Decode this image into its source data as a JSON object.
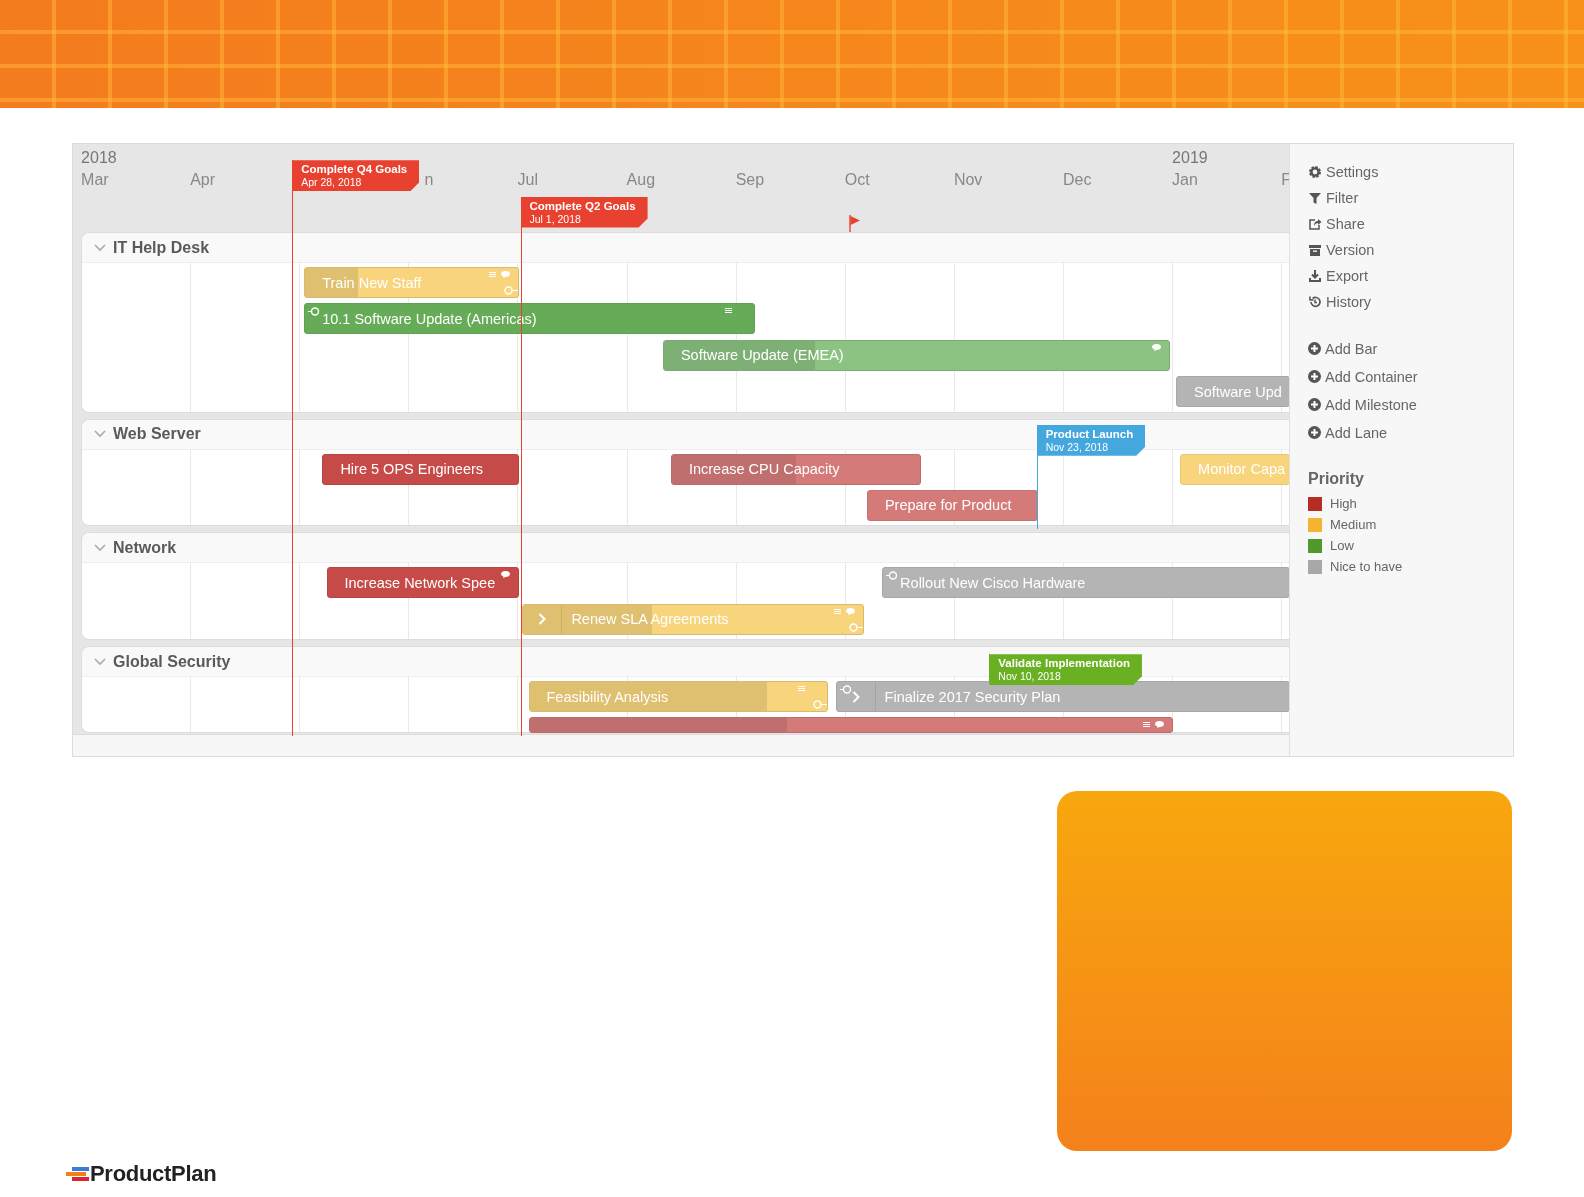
{
  "timeline": {
    "months": [
      {
        "label": "Mar",
        "year": "2018"
      },
      {
        "label": "Apr"
      },
      {
        "label": "n"
      },
      {
        "label": "Jul"
      },
      {
        "label": "Aug"
      },
      {
        "label": "Sep"
      },
      {
        "label": "Oct"
      },
      {
        "label": "Nov"
      },
      {
        "label": "Dec"
      },
      {
        "label": "Jan",
        "year": "2019"
      },
      {
        "label": "F"
      }
    ],
    "milestones": [
      {
        "label": "Complete Q4 Goals",
        "date": "Apr 28, 2018",
        "color": "#e8412f"
      },
      {
        "label": "Complete Q2 Goals",
        "date": "Jul 1, 2018",
        "color": "#e8412f"
      },
      {
        "label": "Product Launch",
        "date": "Nov 23, 2018",
        "color": "#44a7de"
      },
      {
        "label": "Validate Implementation",
        "date": "Nov 10, 2018",
        "color": "#6ab023"
      }
    ],
    "lanes": [
      {
        "name": "IT Help Desk",
        "expanded": true,
        "bars": [
          {
            "label": "Train New Staff",
            "color": "#f8d57d",
            "kind": "bar",
            "level": 0.25,
            "notes": true,
            "comment": true,
            "link_in": false,
            "link_out": true
          },
          {
            "label": "10.1 Software Update (Americas)",
            "color": "#66ac58",
            "kind": "bar",
            "notes": true,
            "comment": false,
            "link_in": true,
            "link_out": false
          },
          {
            "label": "Software Update (EMEA)",
            "color": "#8cc383",
            "kind": "bar",
            "level": 0.3,
            "notes": false,
            "comment": true,
            "link_in": false,
            "link_out": false
          },
          {
            "label": "Software Upd",
            "color": "#b4b4b4",
            "kind": "bar",
            "notes": false,
            "comment": false,
            "link_in": false,
            "link_out": false
          }
        ]
      },
      {
        "name": "Web Server",
        "expanded": true,
        "bars": [
          {
            "label": "Hire 5 OPS Engineers",
            "color": "#c64a48",
            "kind": "bar",
            "notes": false,
            "comment": false,
            "link_in": false,
            "link_out": false
          },
          {
            "label": "Increase CPU Capacity",
            "color": "#d47b79",
            "kind": "bar",
            "level": 0.5,
            "notes": false,
            "comment": false,
            "link_in": false,
            "link_out": false
          },
          {
            "label": "Prepare for Product",
            "color": "#d47b79",
            "kind": "bar",
            "notes": false,
            "comment": false,
            "link_in": false,
            "link_out": false
          },
          {
            "label": "Monitor Capa",
            "color": "#f8d57d",
            "kind": "bar",
            "notes": false,
            "comment": false,
            "link_in": false,
            "link_out": false
          }
        ]
      },
      {
        "name": "Network",
        "expanded": true,
        "bars": [
          {
            "label": "Increase Network Spee",
            "color": "#c64a48",
            "kind": "bar",
            "notes": false,
            "comment": true,
            "link_in": false,
            "link_out": false
          },
          {
            "label": "Rollout New Cisco Hardware",
            "color": "#b4b4b4",
            "kind": "bar",
            "notes": false,
            "comment": false,
            "link_in": true,
            "link_out": false
          },
          {
            "label": "Renew SLA Agreements",
            "color": "#f8d57d",
            "kind": "container",
            "level": 0.38,
            "notes": true,
            "comment": true,
            "link_in": false,
            "link_out": true
          }
        ]
      },
      {
        "name": "Global Security",
        "expanded": true,
        "bars": [
          {
            "label": "Feasibility Analysis",
            "color": "#f8d57d",
            "kind": "bar",
            "level": 0.8,
            "notes": true,
            "comment": false,
            "link_in": false,
            "link_out": true
          },
          {
            "label": "Finalize 2017 Security Plan",
            "color": "#b4b4b4",
            "kind": "container",
            "notes": false,
            "comment": false,
            "link_in": true,
            "link_out": false
          },
          {
            "color": "#d47b79",
            "kind": "bar",
            "level": 0.4,
            "notes": true,
            "comment": true,
            "link_in": false,
            "link_out": false
          }
        ]
      }
    ]
  },
  "sidebar": {
    "menu": [
      {
        "label": "Settings"
      },
      {
        "label": "Filter"
      },
      {
        "label": "Share"
      },
      {
        "label": "Version"
      },
      {
        "label": "Export"
      },
      {
        "label": "History"
      }
    ],
    "add_menu": [
      {
        "label": "Add Bar"
      },
      {
        "label": "Add Container"
      },
      {
        "label": "Add Milestone"
      },
      {
        "label": "Add Lane"
      }
    ],
    "legend": {
      "title": "Priority",
      "items": [
        {
          "label": "High",
          "color": "#b52d25"
        },
        {
          "label": "Medium",
          "color": "#f5b332"
        },
        {
          "label": "Low",
          "color": "#4f9a2a"
        },
        {
          "label": "Nice to have",
          "color": "#a8a8a8"
        }
      ]
    }
  },
  "logo": {
    "text": "ProductPlan"
  }
}
